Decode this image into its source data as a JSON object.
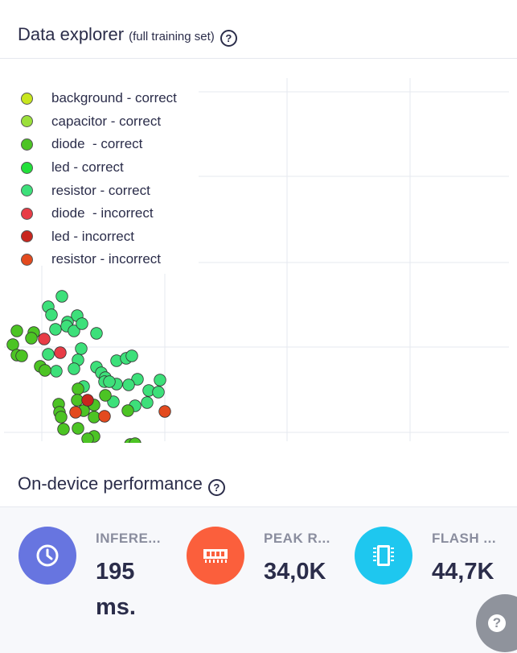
{
  "data_explorer": {
    "title": "Data explorer",
    "subtitle": "(full training set)",
    "help": "?"
  },
  "legend": [
    {
      "label": "background - correct",
      "color": "#c8e61e"
    },
    {
      "label": "capacitor - correct",
      "color": "#9be03a"
    },
    {
      "label": "diode  - correct",
      "color": "#4cc424"
    },
    {
      "label": "led - correct",
      "color": "#22e03a"
    },
    {
      "label": "resistor - correct",
      "color": "#3de07a"
    },
    {
      "label": "diode  - incorrect",
      "color": "#e83c46"
    },
    {
      "label": "led - incorrect",
      "color": "#c8261e"
    },
    {
      "label": "resistor - incorrect",
      "color": "#e34a1e"
    }
  ],
  "chart_data": {
    "type": "scatter",
    "title": "",
    "xlabel": "",
    "ylabel": "",
    "grid": true,
    "legend_placement": "top-left",
    "series": [
      {
        "name": "resistor - correct",
        "color": "#3de07a",
        "points": [
          [
            77,
            368
          ],
          [
            60,
            381
          ],
          [
            64,
            391
          ],
          [
            96,
            392
          ],
          [
            69,
            409
          ],
          [
            84,
            400
          ],
          [
            83,
            405
          ],
          [
            92,
            411
          ],
          [
            102,
            402
          ],
          [
            120,
            414
          ],
          [
            60,
            440
          ],
          [
            101,
            433
          ],
          [
            97,
            447
          ],
          [
            92,
            458
          ],
          [
            70,
            461
          ],
          [
            120,
            456
          ],
          [
            126,
            463
          ],
          [
            131,
            469
          ],
          [
            145,
            448
          ],
          [
            157,
            445
          ],
          [
            164,
            442
          ],
          [
            145,
            477
          ],
          [
            171,
            471
          ],
          [
            199,
            472
          ],
          [
            160,
            478
          ],
          [
            130,
            474
          ],
          [
            136,
            474
          ],
          [
            104,
            480
          ],
          [
            185,
            485
          ],
          [
            197,
            487
          ],
          [
            183,
            500
          ],
          [
            168,
            504
          ],
          [
            141,
            499
          ]
        ]
      },
      {
        "name": "diode  - correct",
        "color": "#4cc424",
        "points": [
          [
            21,
            411
          ],
          [
            42,
            413
          ],
          [
            16,
            428
          ],
          [
            39,
            420
          ],
          [
            21,
            441
          ],
          [
            27,
            442
          ],
          [
            50,
            455
          ],
          [
            56,
            460
          ],
          [
            97,
            483
          ],
          [
            96,
            497
          ],
          [
            131,
            491
          ],
          [
            117,
            503
          ],
          [
            73,
            502
          ],
          [
            74,
            512
          ],
          [
            104,
            510
          ],
          [
            76,
            518
          ],
          [
            79,
            533
          ],
          [
            97,
            532
          ],
          [
            117,
            518
          ],
          [
            159,
            510
          ],
          [
            117,
            542
          ],
          [
            109,
            545
          ],
          [
            162,
            552
          ],
          [
            168,
            551
          ]
        ]
      },
      {
        "name": "diode  - incorrect",
        "color": "#e83c46",
        "points": [
          [
            55,
            421
          ],
          [
            75,
            438
          ]
        ]
      },
      {
        "name": "led - incorrect",
        "color": "#c8261e",
        "points": [
          [
            109,
            497
          ]
        ]
      },
      {
        "name": "resistor - incorrect",
        "color": "#e34a1e",
        "points": [
          [
            94,
            512
          ],
          [
            130,
            517
          ],
          [
            205,
            511
          ]
        ]
      }
    ]
  },
  "on_device": {
    "title": "On-device performance",
    "help": "?"
  },
  "metrics": [
    {
      "label": "INFERE...",
      "value": "195 ms.",
      "color": "#6775e0",
      "icon": "clock-icon"
    },
    {
      "label": "PEAK R...",
      "value": "34,0K",
      "color": "#fb5f3c",
      "icon": "ram-icon"
    },
    {
      "label": "FLASH ...",
      "value": "44,7K",
      "color": "#1ec7ef",
      "icon": "chip-icon"
    }
  ],
  "fab": {
    "label": "?"
  }
}
